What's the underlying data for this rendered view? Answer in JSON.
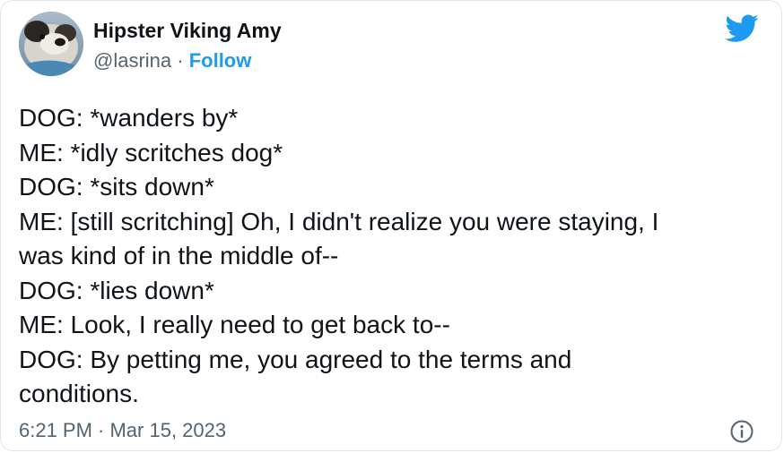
{
  "author": {
    "display_name": "Hipster Viking Amy",
    "handle": "@lasrina",
    "separator": " · ",
    "follow_label": "Follow"
  },
  "tweet": {
    "lines": [
      "DOG: *wanders by*",
      "ME: *idly scritches dog*",
      "DOG: *sits down*",
      "ME: [still scritching] Oh, I didn't realize you were staying, I",
      "was kind of in the middle of--",
      "DOG: *lies down*",
      "ME: Look, I really need to get back to--",
      "DOG: By petting me, you agreed to the terms and",
      "conditions."
    ],
    "timestamp": "6:21 PM · Mar 15, 2023"
  },
  "icons": {
    "brand": "twitter-bird-icon",
    "info": "info-icon"
  },
  "colors": {
    "brand_blue": "#1d9bf0",
    "text_primary": "#0f1419",
    "text_secondary": "#536471"
  }
}
